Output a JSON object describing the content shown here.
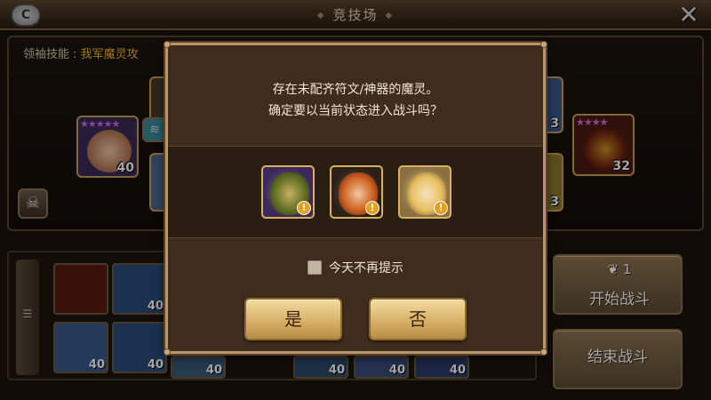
{
  "topbar": {
    "back_label": "C",
    "title": "竞技场",
    "close_label": "✕"
  },
  "field": {
    "leader_prefix": "领袖技能 : ",
    "leader_text": "我军魔灵攻",
    "monsters": [
      {
        "level": "40",
        "stars": "★★★★★"
      },
      {
        "level": "32",
        "stars": "★★★★"
      },
      {
        "level": "3",
        "stars": ""
      },
      {
        "level": "3",
        "stars": ""
      }
    ]
  },
  "storage": {
    "levels": [
      "40",
      "40",
      "40",
      "40",
      "40",
      "40",
      "40"
    ]
  },
  "side": {
    "start_cost": "1",
    "start_label": "开始战斗",
    "end_label": "结束战斗"
  },
  "dialog": {
    "line1": "存在未配齐符文/神器的魔灵。",
    "line2": "确定要以当前状态进入战斗吗？",
    "checkbox_label": "今天不再提示",
    "yes_label": "是",
    "no_label": "否",
    "warn_mark": "!"
  }
}
